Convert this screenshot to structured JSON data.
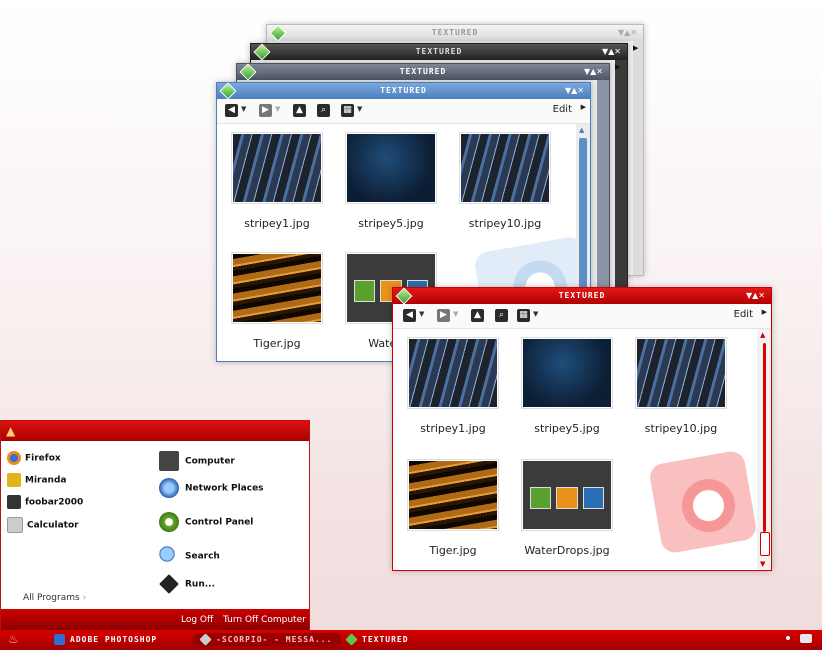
{
  "colors": {
    "accent_red": "#cc0000",
    "blue_title": "#5b8fc7"
  },
  "back_windows": [
    {
      "title": "TEXTURED",
      "controls": "▼▲✕"
    },
    {
      "title": "TEXTURED",
      "controls": "▼▲✕"
    },
    {
      "title": "TEXTURED",
      "controls": "▼▲✕"
    }
  ],
  "blue_window": {
    "title": "TEXTURED",
    "controls": "▼▲✕",
    "edit_label": "Edit",
    "files": [
      "stripey1.jpg",
      "stripey5.jpg",
      "stripey10.jpg",
      "Tiger.jpg",
      "WaterDr"
    ]
  },
  "red_window": {
    "title": "TEXTURED",
    "controls": "▼▲✕",
    "edit_label": "Edit",
    "files": [
      "stripey1.jpg",
      "stripey5.jpg",
      "stripey10.jpg",
      "Tiger.jpg",
      "WaterDrops.jpg"
    ]
  },
  "start_menu": {
    "pinned": [
      "Firefox",
      "Miranda",
      "foobar2000",
      "Calculator"
    ],
    "all_programs": "All Programs",
    "places": [
      "Computer",
      "Network Places",
      "Control Panel",
      "Search",
      "Run..."
    ],
    "log_off": "Log Off",
    "turn_off": "Turn Off Computer"
  },
  "taskbar": {
    "tasks": [
      "ADOBE PHOTOSHOP",
      "-SCORPIO- - MESSA...",
      "TEXTURED"
    ]
  }
}
